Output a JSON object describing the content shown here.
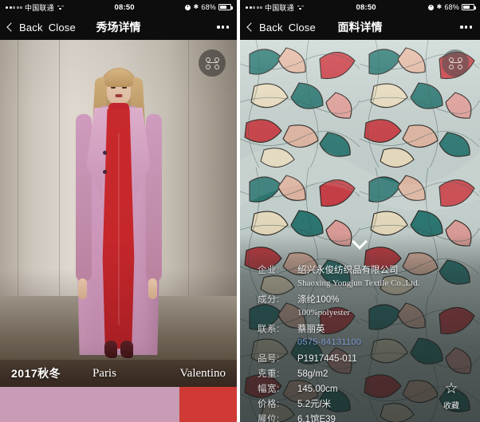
{
  "left_panel": {
    "status_bar": {
      "carrier": "中国联通",
      "wifi_icon": "wifi-icon",
      "time": "08:50",
      "alarm_icon": "alarm-icon",
      "bluetooth_icon": "bluetooth-icon",
      "battery_percent": "68%",
      "battery_level": 68
    },
    "nav_bar": {
      "back_label": "Back",
      "close_label": "Close",
      "title": "秀场详情",
      "more_icon": "more-dots-icon",
      "back_icon": "chevron-left-icon"
    },
    "share_button_icon": "share-icon",
    "caption": {
      "season": "2017秋冬",
      "city": "Paris",
      "brand": "Valentino"
    },
    "swatches": [
      {
        "name": "pink-swatch",
        "color": "#c79cb4"
      },
      {
        "name": "red-swatch",
        "color": "#cf3a35"
      }
    ]
  },
  "right_panel": {
    "status_bar": {
      "carrier": "中国联通",
      "wifi_icon": "wifi-icon",
      "time": "08:50",
      "alarm_icon": "alarm-icon",
      "bluetooth_icon": "bluetooth-icon",
      "battery_percent": "68%",
      "battery_level": 68
    },
    "nav_bar": {
      "back_label": "Back",
      "close_label": "Close",
      "title": "面料详情",
      "more_icon": "more-dots-icon",
      "back_icon": "chevron-left-icon"
    },
    "share_button_icon": "share-icon",
    "expand_icon": "chevron-down-icon",
    "details": {
      "company_label": "企业:",
      "company_value": "绍兴永俊纺织品有限公司",
      "company_value_en": "Shaoxing Yongjun Textile Co.,Ltd.",
      "composition_label": "成分:",
      "composition_value": "涤纶100%",
      "composition_value_en": "100%polyester",
      "contact_label": "联系:",
      "contact_value": "蔡丽英",
      "contact_phone": "0575-84131100",
      "item_no_label": "品号:",
      "item_no_value": "P1917445-011",
      "weight_label": "克重:",
      "weight_value": "58g/m2",
      "width_label": "幅宽:",
      "width_value": "145.00cm",
      "price_label": "价格:",
      "price_value": "5.2元/米",
      "booth_label": "展位:",
      "booth_value": "6.1馆E39"
    },
    "favorite": {
      "icon": "star-outline-icon",
      "label": "收藏"
    }
  },
  "theme": {
    "nav_background": "#0d0d0d",
    "accent_pink": "#c79cb4",
    "accent_red": "#cf3a35",
    "link_blue": "#7f9fd6"
  }
}
